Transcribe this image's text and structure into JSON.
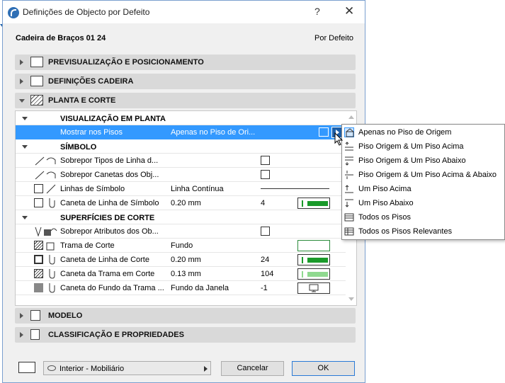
{
  "window": {
    "title": "Definições de Objecto por Defeito",
    "help": "?",
    "close": "✕"
  },
  "object": {
    "name": "Cadeira de Braços 01 24",
    "default_label": "Por Defeito"
  },
  "sections": {
    "preview": "PREVISUALIZAÇÃO E POSICIONAMENTO",
    "chair": "DEFINIÇÕES CADEIRA",
    "plan": "PLANTA E CORTE",
    "model": "MODELO",
    "classification": "CLASSIFICAÇÃO E PROPRIEDADES"
  },
  "groups": {
    "plan_view": "VISUALIZAÇÃO EM PLANTA",
    "symbol": "SÍMBOLO",
    "cut_surfaces": "SUPERFÍCIES DE CORTE"
  },
  "rows": {
    "show_on_stories": {
      "label": "Mostrar nos Pisos",
      "value": "Apenas no Piso de Ori..."
    },
    "override_line_types": {
      "label": "Sobrepor Tipos de Linha d..."
    },
    "override_pens": {
      "label": "Sobrepor Canetas dos Obj..."
    },
    "symbol_lines": {
      "label": "Linhas de Símbolo",
      "value": "Linha Contínua"
    },
    "symbol_line_pen": {
      "label": "Caneta de Linha de Símbolo",
      "value": "0.20 mm",
      "num": "4"
    },
    "override_cut_attrs": {
      "label": "Sobrepor Atributos dos Ob..."
    },
    "cut_fill": {
      "label": "Trama de Corte",
      "value": "Fundo"
    },
    "cut_line_pen": {
      "label": "Caneta de Linha de Corte",
      "value": "0.20 mm",
      "num": "24"
    },
    "cut_fill_pen": {
      "label": "Caneta da Trama em Corte",
      "value": "0.13 mm",
      "num": "104"
    },
    "cut_bg_pen": {
      "label": "Caneta do Fundo da Trama ...",
      "value": "Fundo da Janela",
      "num": "-1"
    }
  },
  "footer": {
    "layer": "Interior - Mobiliário",
    "cancel": "Cancelar",
    "ok": "OK"
  },
  "popup": {
    "items": [
      "Apenas no Piso de Origem",
      "Piso Origem & Um Piso Acima",
      "Piso Origem & Um Piso Abaixo",
      "Piso Origem & Um Piso Acima & Abaixo",
      "Um Piso Acima",
      "Um Piso Abaixo",
      "Todos os Pisos",
      "Todos os Pisos Relevantes"
    ],
    "selected_index": 0
  },
  "colors": {
    "selection": "#3399ff",
    "pen_green": "#1a9a2a",
    "pen_light_green": "#8fd98f",
    "section_bg": "#d9d9d9"
  }
}
